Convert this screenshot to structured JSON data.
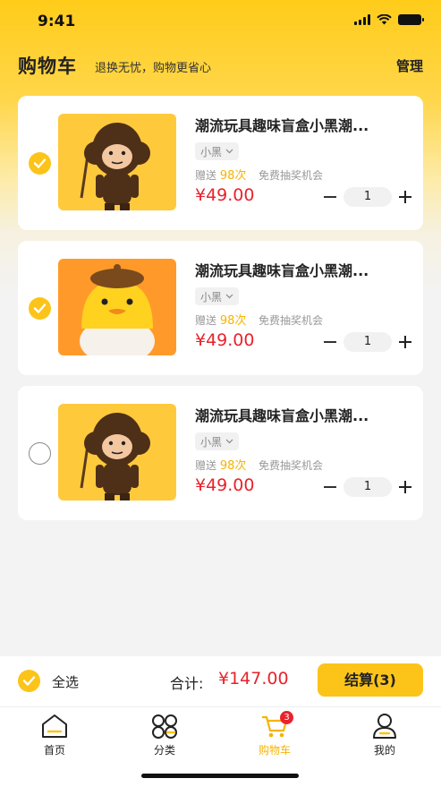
{
  "status_bar": {
    "time": "9:41"
  },
  "header": {
    "title": "购物车",
    "subtitle": "退换无忧，购物更省心",
    "manage_label": "管理"
  },
  "cart": {
    "items": [
      {
        "title": "潮流玩具趣味盲盒小黑潮...",
        "spec": "小黑",
        "gift_prefix": "赠送",
        "gift_count": "98次",
        "gift_suffix": "免费抽奖机会",
        "price": "¥49.00",
        "quantity": "1",
        "checked": true,
        "image": "monkey-figure"
      },
      {
        "title": "潮流玩具趣味盲盒小黑潮...",
        "spec": "小黑",
        "gift_prefix": "赠送",
        "gift_count": "98次",
        "gift_suffix": "免费抽奖机会",
        "price": "¥49.00",
        "quantity": "1",
        "checked": true,
        "image": "duck-figure"
      },
      {
        "title": "潮流玩具趣味盲盒小黑潮...",
        "spec": "小黑",
        "gift_prefix": "赠送",
        "gift_count": "98次",
        "gift_suffix": "免费抽奖机会",
        "price": "¥49.00",
        "quantity": "1",
        "checked": false,
        "image": "monkey-figure"
      }
    ]
  },
  "checkout": {
    "select_all_label": "全选",
    "total_label": "合计:",
    "total_value": "¥147.00",
    "settle_label": "结算(3)"
  },
  "tab_bar": {
    "tabs": [
      {
        "label": "首页",
        "icon": "home-icon"
      },
      {
        "label": "分类",
        "icon": "category-icon"
      },
      {
        "label": "购物车",
        "icon": "cart-icon",
        "active": true,
        "badge": "3"
      },
      {
        "label": "我的",
        "icon": "profile-icon"
      }
    ]
  },
  "colors": {
    "accent": "#fcc419",
    "price": "#e8232c",
    "gift_count": "#f6b400"
  }
}
